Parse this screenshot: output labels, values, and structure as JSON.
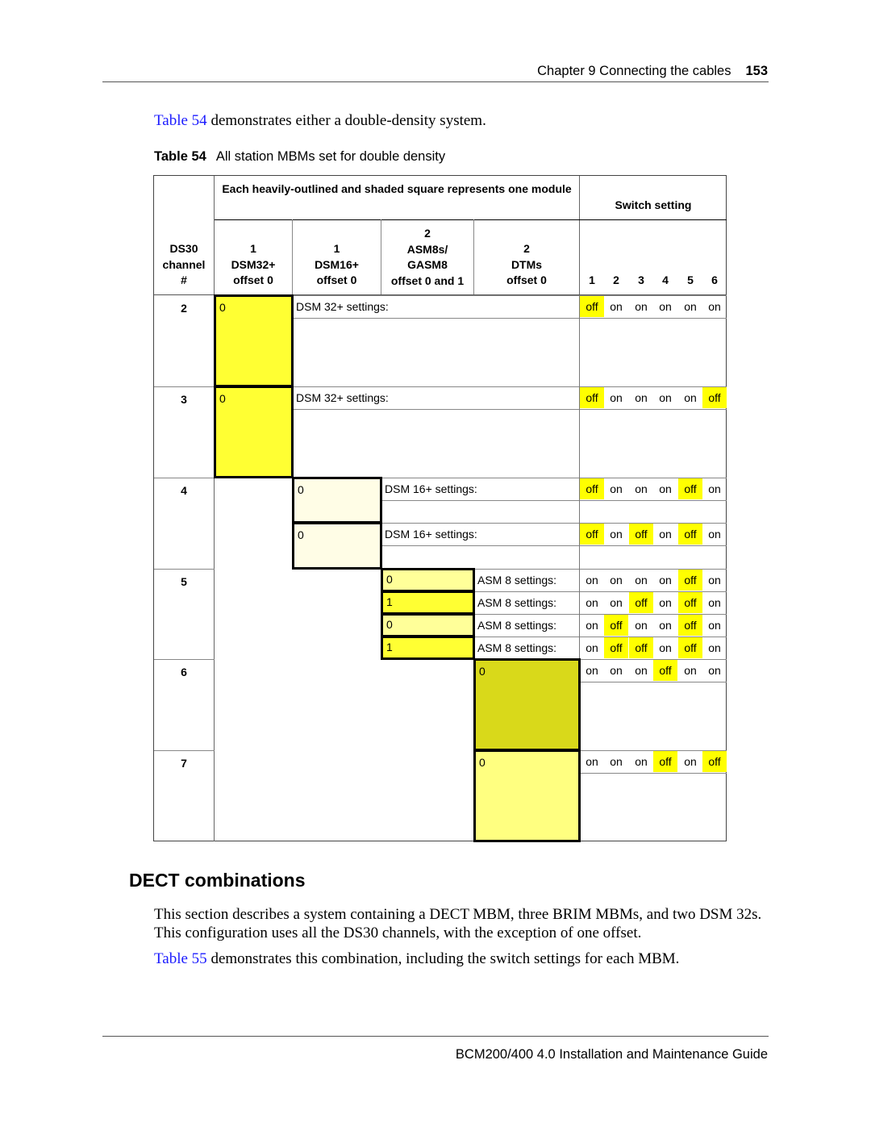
{
  "header": {
    "chapter": "Chapter 9  Connecting the cables",
    "page_number": "153"
  },
  "intro": {
    "link": "Table 54",
    "text": " demonstrates either a double-density system."
  },
  "caption": {
    "label": "Table 54",
    "title": "All station MBMs set for double density"
  },
  "table": {
    "group_header": "Each heavily-outlined and shaded square represents one module",
    "switch_header": "Switch setting",
    "columns": {
      "ds30": [
        "DS30",
        "channel",
        "#"
      ],
      "dsm32": [
        "1",
        "DSM32+",
        "offset 0"
      ],
      "dsm16": [
        "1",
        "DSM16+",
        "offset 0"
      ],
      "asm8": [
        "2",
        "ASM8s/",
        "GASM8",
        "offset 0 and 1"
      ],
      "dtm": [
        "2",
        "DTMs",
        "offset 0"
      ],
      "switches": [
        "1",
        "2",
        "3",
        "4",
        "5",
        "6"
      ]
    },
    "channels": [
      "2",
      "3",
      "4",
      "5",
      "6",
      "7"
    ],
    "rows": [
      {
        "offset": "0",
        "label": "DSM 32+ settings:",
        "switches": [
          "off",
          "on",
          "on",
          "on",
          "on",
          "on"
        ]
      },
      {
        "offset": "0",
        "label": "DSM 32+ settings:",
        "switches": [
          "off",
          "on",
          "on",
          "on",
          "on",
          "off"
        ]
      },
      {
        "offset": "0",
        "label": "DSM 16+ settings:",
        "switches": [
          "off",
          "on",
          "on",
          "on",
          "off",
          "on"
        ]
      },
      {
        "offset": "0",
        "label": "DSM 16+ settings:",
        "switches": [
          "off",
          "on",
          "off",
          "on",
          "off",
          "on"
        ]
      },
      {
        "offset": "0",
        "label": "ASM 8 settings:",
        "switches": [
          "on",
          "on",
          "on",
          "on",
          "off",
          "on"
        ]
      },
      {
        "offset": "1",
        "label": "ASM 8 settings:",
        "switches": [
          "on",
          "on",
          "off",
          "on",
          "off",
          "on"
        ]
      },
      {
        "offset": "0",
        "label": "ASM 8 settings:",
        "switches": [
          "on",
          "off",
          "on",
          "on",
          "off",
          "on"
        ]
      },
      {
        "offset": "1",
        "label": "ASM 8 settings:",
        "switches": [
          "on",
          "off",
          "off",
          "on",
          "off",
          "on"
        ]
      },
      {
        "offset": "0",
        "label": "",
        "switches": [
          "on",
          "on",
          "on",
          "off",
          "on",
          "on"
        ]
      },
      {
        "offset": "0",
        "label": "",
        "switches": [
          "on",
          "on",
          "on",
          "off",
          "on",
          "off"
        ]
      }
    ],
    "colors": {
      "dsm32": "#ffff33",
      "dsm16": "#fffde6",
      "asm8_light": "#ffff99",
      "asm8_dark": "#ffff33",
      "dtm_dark": "#d9d91a",
      "dtm_light": "#ffff80",
      "off_highlight": "#ffff00"
    }
  },
  "section": {
    "title": "DECT combinations",
    "para1_line1": "This section describes a system containing a DECT MBM, three BRIM MBMs, and two DSM 32s.",
    "para1_line2": "This configuration uses all the DS30 channels, with the exception of one offset.",
    "para2_link": "Table 55",
    "para2_text": " demonstrates this combination, including the switch settings for each MBM."
  },
  "footer": {
    "title": "BCM200/400 4.0 Installation and Maintenance Guide"
  }
}
